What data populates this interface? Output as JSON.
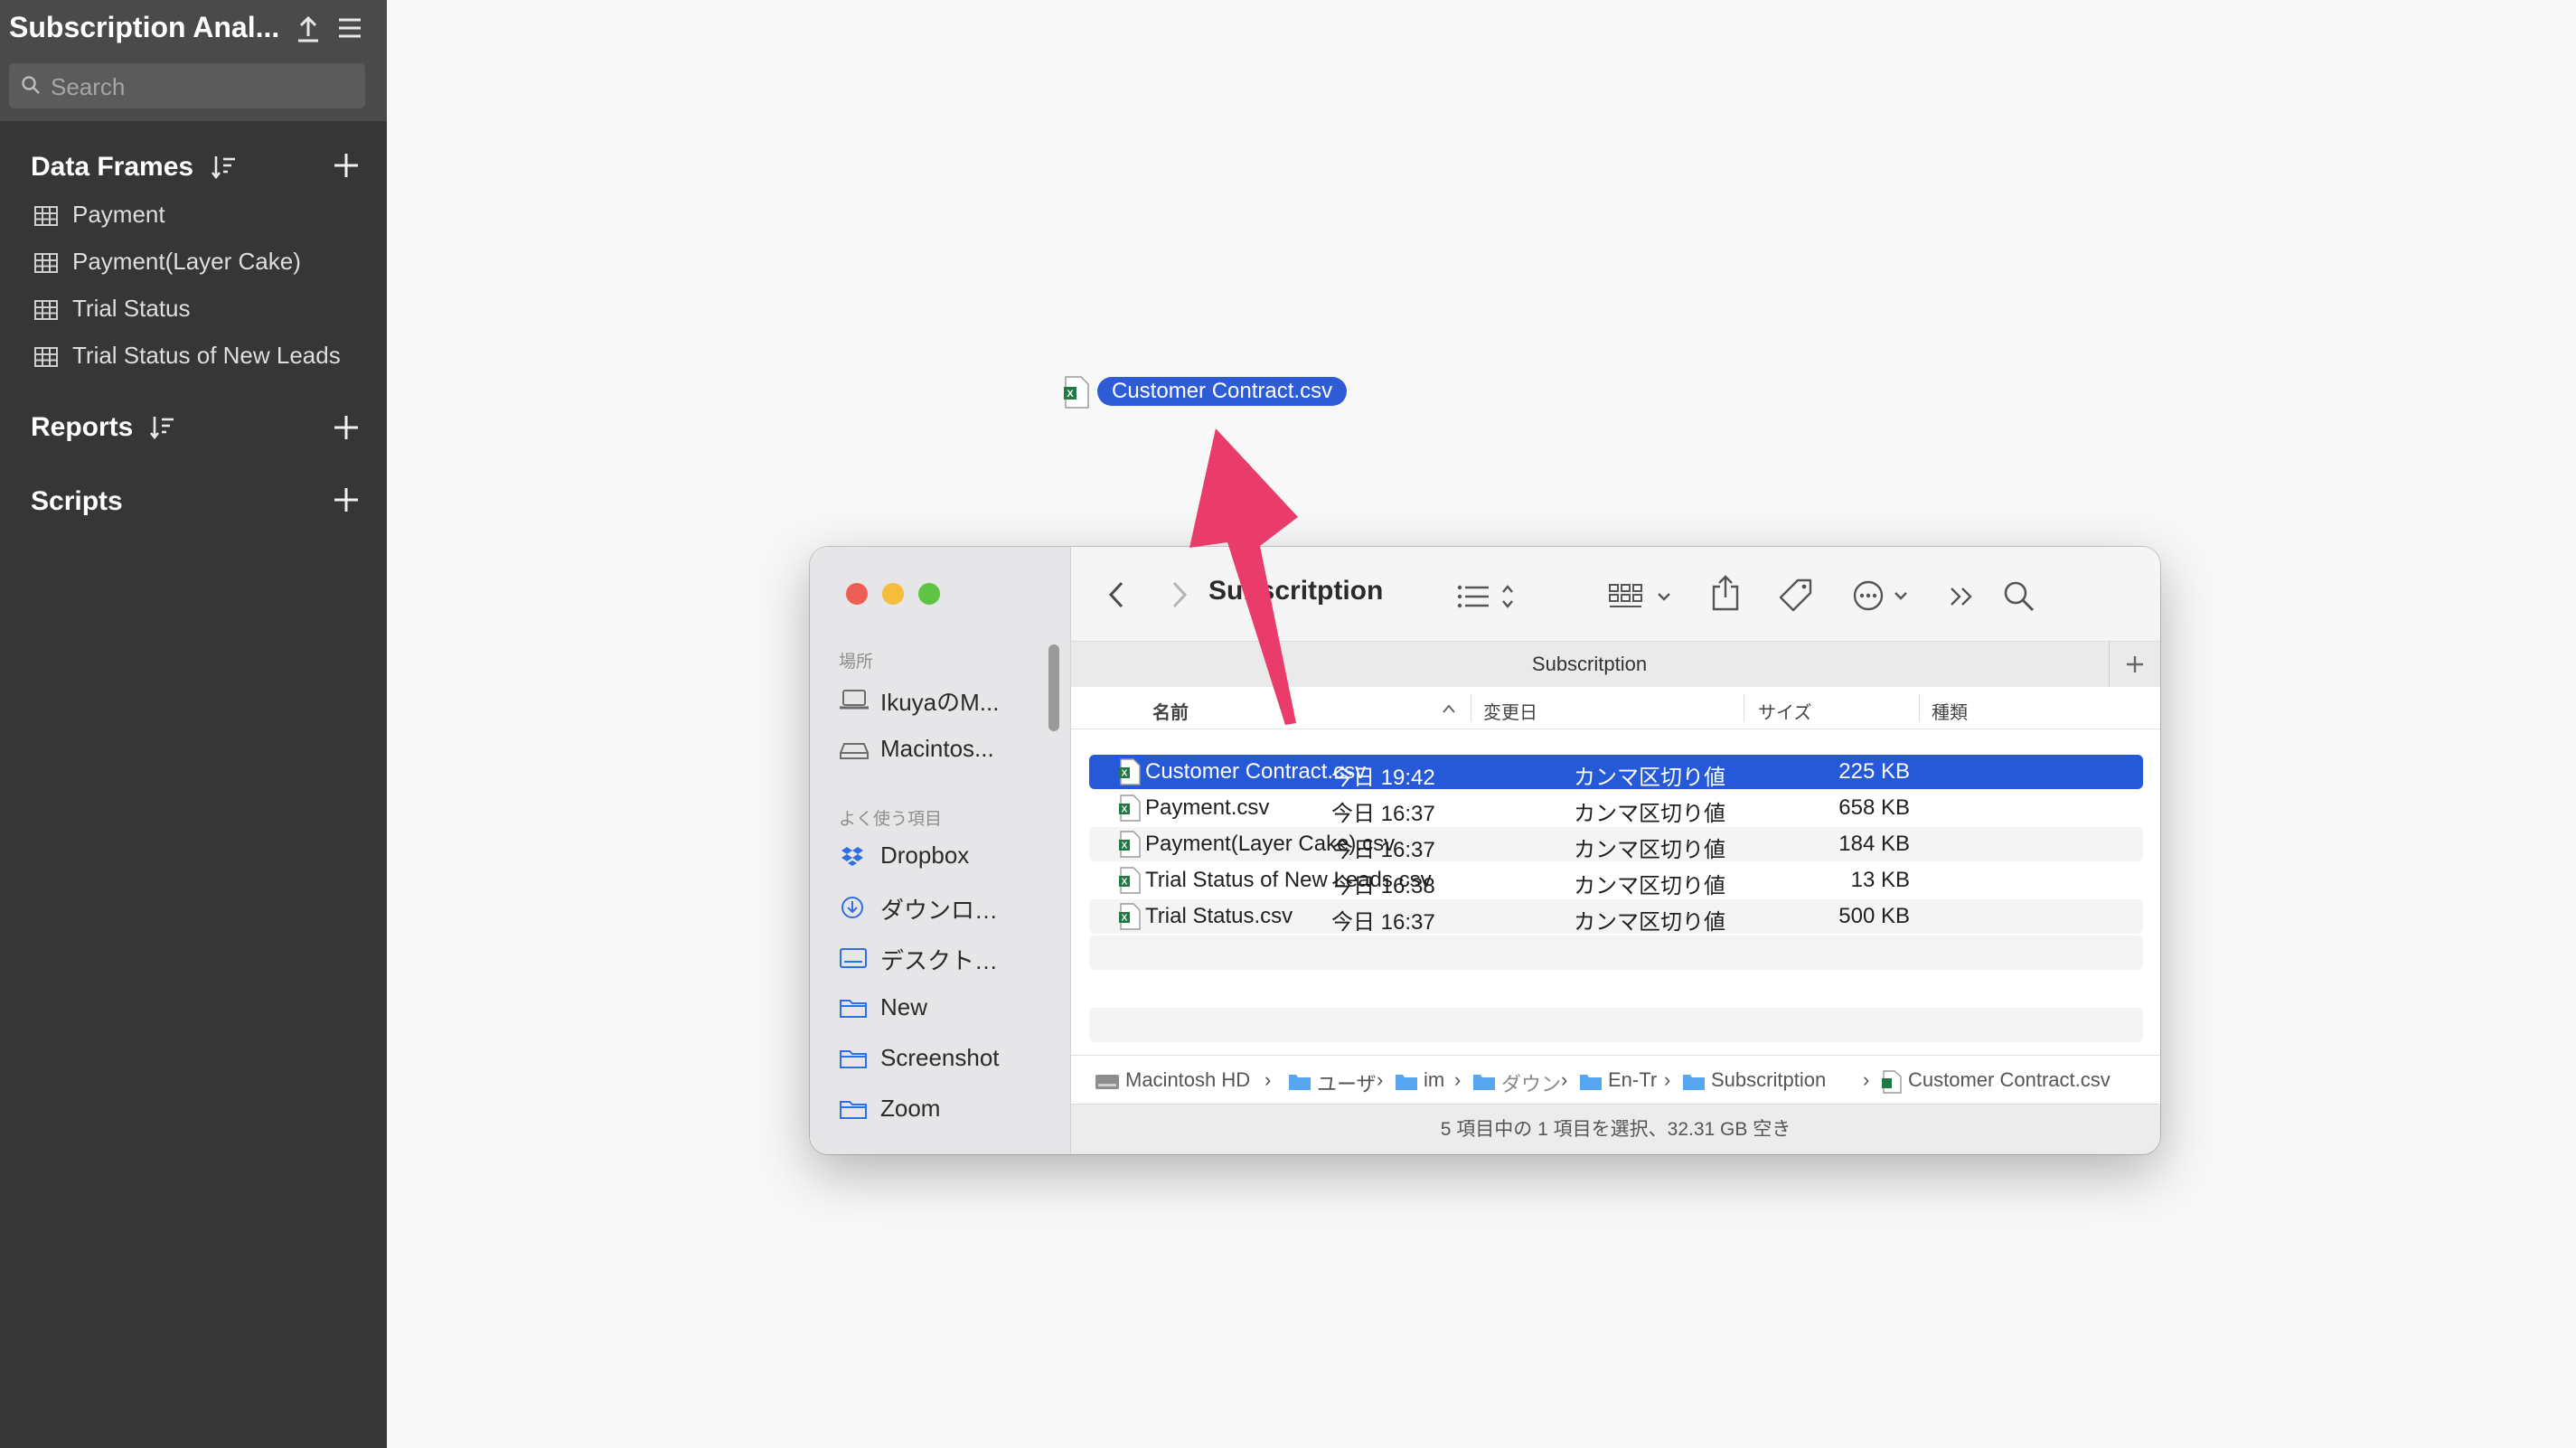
{
  "app": {
    "title": "Subscription Anal...",
    "search_placeholder": "Search",
    "sections": {
      "data_frames": "Data Frames",
      "reports": "Reports",
      "scripts": "Scripts"
    },
    "data_frames": [
      "Payment",
      "Payment(Layer Cake)",
      "Trial Status",
      "Trial Status of New Leads"
    ]
  },
  "drag": {
    "filename": "Customer Contract.csv"
  },
  "finder": {
    "title": "Subscritption",
    "tab_title": "Subscritption",
    "sidebar": {
      "group_places": "場所",
      "group_favorites": "よく使う項目",
      "places": [
        {
          "label": "IkuyaのM...",
          "icon": "laptop-icon"
        },
        {
          "label": "Macintos...",
          "icon": "drive-icon"
        }
      ],
      "favorites": [
        {
          "label": "Dropbox",
          "icon": "dropbox-icon"
        },
        {
          "label": "ダウンロ…",
          "icon": "download-icon"
        },
        {
          "label": "デスクト…",
          "icon": "desktop-icon"
        },
        {
          "label": "New",
          "icon": "folder-icon"
        },
        {
          "label": "Screenshot",
          "icon": "folder-icon"
        },
        {
          "label": "Zoom",
          "icon": "folder-icon"
        }
      ]
    },
    "columns": {
      "name": "名前",
      "modified": "変更日",
      "size": "サイズ",
      "kind": "種類"
    },
    "files": [
      {
        "name": "Customer Contract.csv",
        "modified": "今日 19:42",
        "size": "225 KB",
        "kind": "カンマ区切り値",
        "selected": true
      },
      {
        "name": "Payment.csv",
        "modified": "今日 16:37",
        "size": "658 KB",
        "kind": "カンマ区切り値"
      },
      {
        "name": "Payment(Layer Cake).csv",
        "modified": "今日 16:37",
        "size": "184 KB",
        "kind": "カンマ区切り値"
      },
      {
        "name": "Trial Status of New Leads.csv",
        "modified": "今日 16:38",
        "size": "13 KB",
        "kind": "カンマ区切り値"
      },
      {
        "name": "Trial Status.csv",
        "modified": "今日 16:37",
        "size": "500 KB",
        "kind": "カンマ区切り値"
      }
    ],
    "path": [
      "Macintosh HD",
      "ユーザ",
      "im",
      "ダウン",
      "En-Tr",
      "Subscritption",
      "Customer Contract.csv"
    ],
    "status": "5 項目中の 1 項目を選択、32.31 GB 空き"
  },
  "colors": {
    "sidebar_bg": "#363636",
    "selection_blue": "#2559d8",
    "arrow": "#ea3c6b"
  }
}
